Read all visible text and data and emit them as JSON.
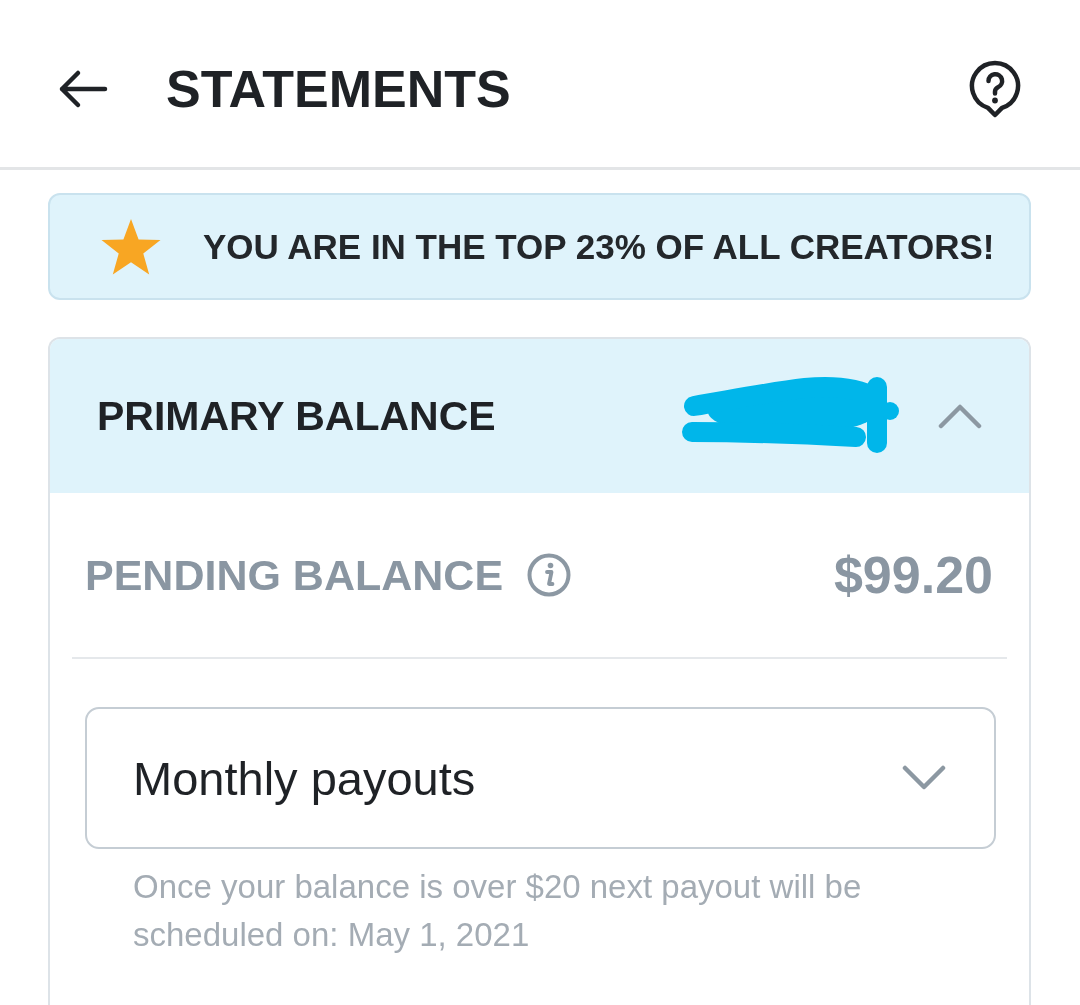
{
  "header": {
    "title": "STATEMENTS"
  },
  "banner": {
    "text": "YOU ARE IN THE TOP 23% OF ALL CREATORS!"
  },
  "primary_balance": {
    "label": "PRIMARY BALANCE",
    "expanded": true,
    "pending": {
      "label": "PENDING BALANCE",
      "amount": "$99.20"
    },
    "payout_select": {
      "value": "Monthly payouts"
    },
    "note": "Once your balance is over $20 next payout will be scheduled on: May 1, 2021"
  }
}
